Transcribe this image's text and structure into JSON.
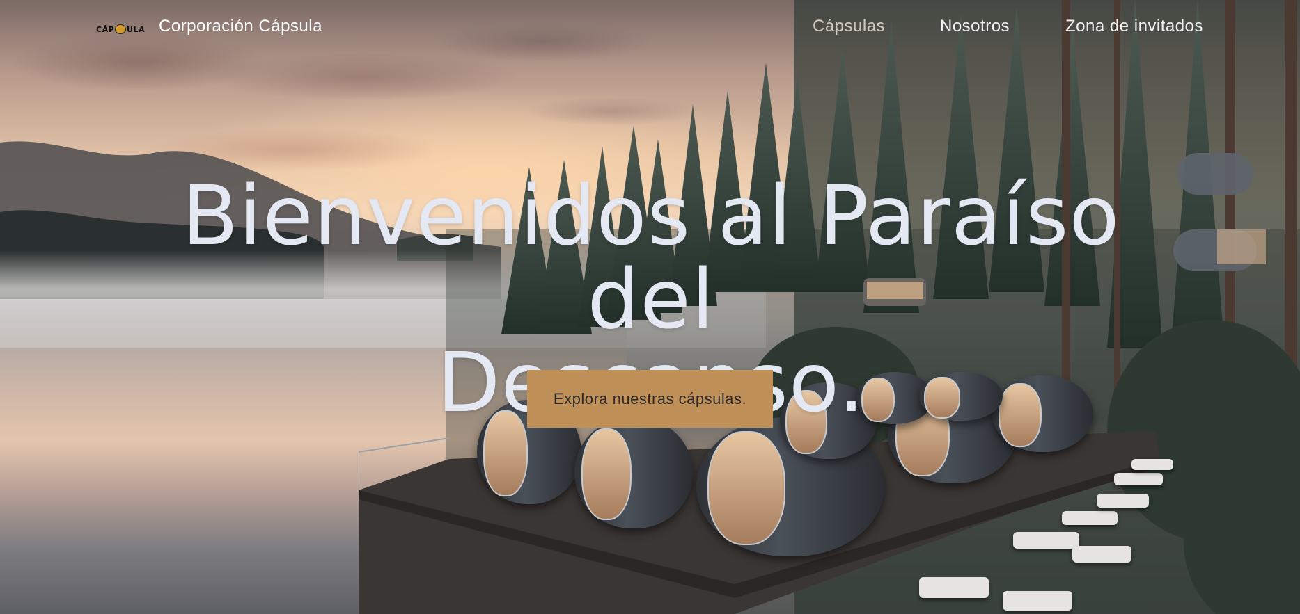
{
  "nav": {
    "logo_text": "CÁPSULA",
    "brand": "Corporación Cápsula",
    "links": [
      "Cápsulas",
      "Nosotros",
      "Zona de invitados"
    ]
  },
  "hero": {
    "headline_line1": "Bienvenidos al Paraíso del",
    "headline_line2": "Descanso.",
    "cta_label": "Explora nuestras cápsulas."
  },
  "colors": {
    "cta_background": "#bf9158",
    "headline_text": "#e3e8f3",
    "nav_text": "#ffffff"
  }
}
